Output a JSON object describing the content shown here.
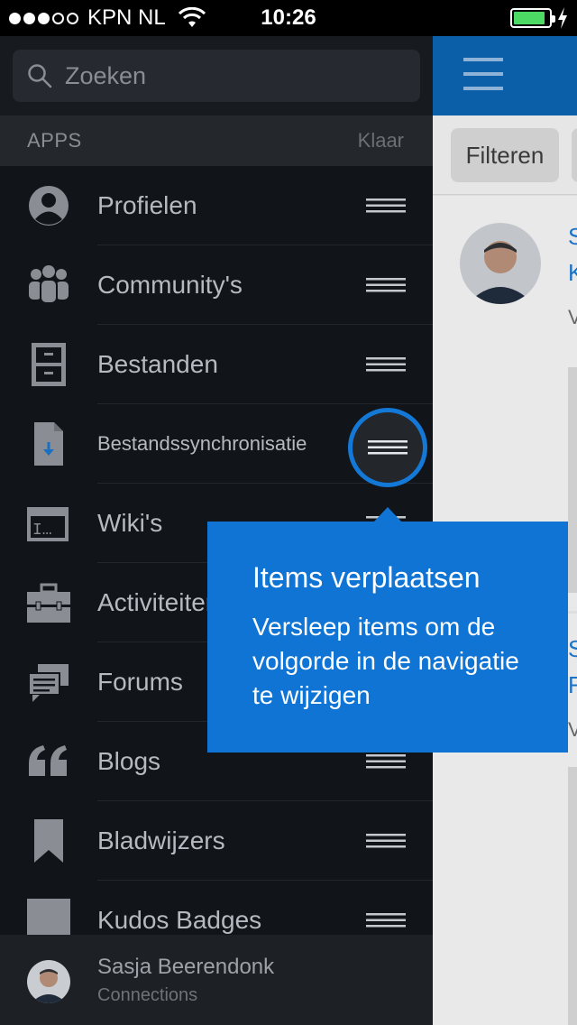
{
  "status_bar": {
    "carrier": "KPN NL",
    "signal_dots_filled": 3,
    "signal_dots_total": 5,
    "time": "10:26",
    "battery_level": 0.9,
    "battery_color": "#4cd964"
  },
  "sidebar": {
    "search_placeholder": "Zoeken",
    "section_label": "APPS",
    "done_label": "Klaar",
    "items": [
      {
        "label": "Profielen",
        "icon": "profile-icon"
      },
      {
        "label": "Community's",
        "icon": "community-icon"
      },
      {
        "label": "Bestanden",
        "icon": "files-icon"
      },
      {
        "label": "Bestandssynchronisatie",
        "icon": "file-sync-icon"
      },
      {
        "label": "Wiki's",
        "icon": "wiki-icon"
      },
      {
        "label": "Activiteiten",
        "icon": "activities-icon"
      },
      {
        "label": "Forums",
        "icon": "forums-icon"
      },
      {
        "label": "Blogs",
        "icon": "blogs-icon"
      },
      {
        "label": "Bladwijzers",
        "icon": "bookmarks-icon"
      },
      {
        "label": "Kudos Badges",
        "icon": "kudos-badges-icon"
      }
    ],
    "footer": {
      "name": "Sasja Beerendonk",
      "subtitle": "Connections"
    }
  },
  "content": {
    "filter_label": "Filteren",
    "header_color": "#0a5fa8",
    "card1_letters": [
      "S",
      "K",
      "V"
    ],
    "card2_letters": [
      "S",
      "F",
      "V"
    ]
  },
  "tooltip": {
    "title": "Items verplaatsen",
    "body": "Versleep items om de volgorde in de navigatie te wijzigen",
    "color": "#0f74d4"
  }
}
